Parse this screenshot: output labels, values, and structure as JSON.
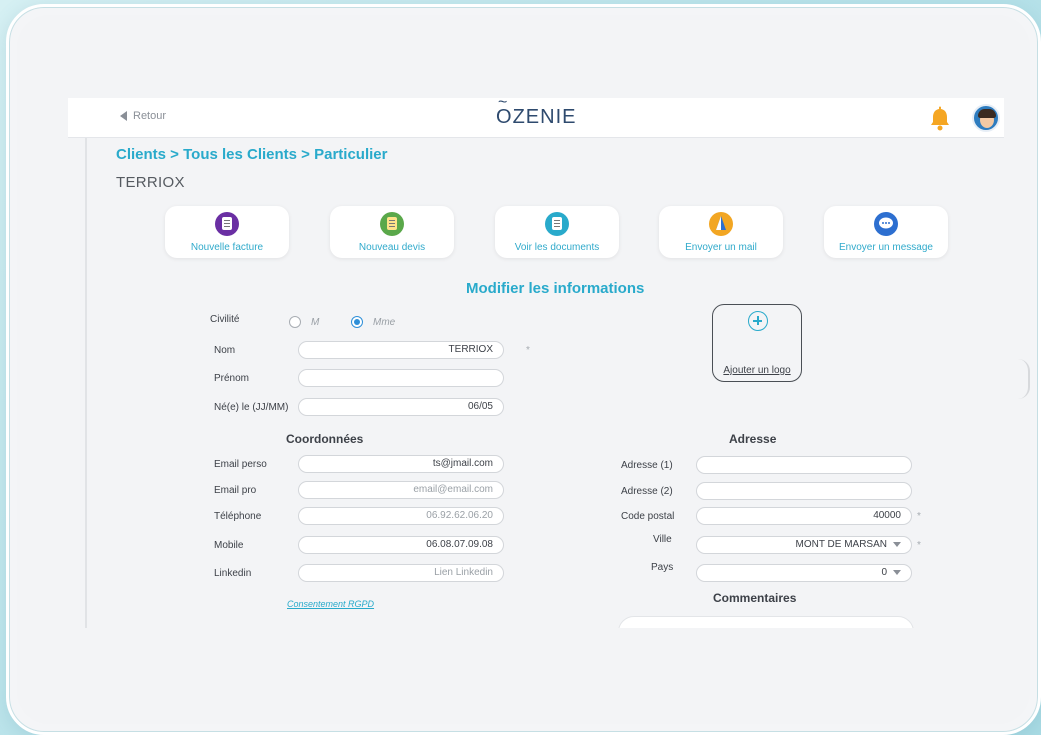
{
  "header": {
    "back_label": "Retour",
    "logo_text": "ZENIE",
    "logo_first_letter": "O"
  },
  "breadcrumb": "Clients > Tous les Clients > Particulier",
  "client_name": "TERRIOX",
  "actions": [
    {
      "label": "Nouvelle facture",
      "icon": "invoice-icon",
      "color": "#6a2fa3"
    },
    {
      "label": "Nouveau devis",
      "icon": "quote-icon",
      "color": "#5aa84a"
    },
    {
      "label": "Voir les documents",
      "icon": "documents-icon",
      "color": "#29aacb"
    },
    {
      "label": "Envoyer un mail",
      "icon": "mail-icon",
      "color": "#f2a623"
    },
    {
      "label": "Envoyer un message",
      "icon": "message-icon",
      "color": "#2d6fd0"
    }
  ],
  "form_title": "Modifier les informations",
  "civilite": {
    "label": "Civilité",
    "options": [
      "M",
      "Mme"
    ],
    "selected": "Mme"
  },
  "identity": {
    "nom_label": "Nom",
    "nom_value": "TERRIOX",
    "prenom_label": "Prénom",
    "prenom_value": "",
    "naissance_label": "Né(e) le (JJ/MM)",
    "naissance_value": "06/05",
    "required_mark": "*"
  },
  "logo_upload": {
    "label": "Ajouter un logo"
  },
  "coordonnees": {
    "title": "Coordonnées",
    "email_perso_label": "Email perso",
    "email_perso_value": "ts@jmail.com",
    "email_pro_label": "Email pro",
    "email_pro_placeholder": "email@email.com",
    "telephone_label": "Téléphone",
    "telephone_placeholder": "06.92.62.06.20",
    "mobile_label": "Mobile",
    "mobile_value": "06.08.07.09.08",
    "linkedin_label": "Linkedin",
    "linkedin_placeholder": "Lien Linkedin",
    "rgpd_link": "Consentement RGPD"
  },
  "adresse": {
    "title": "Adresse",
    "adresse1_label": "Adresse (1)",
    "adresse1_value": "",
    "adresse2_label": "Adresse (2)",
    "adresse2_value": "",
    "code_postal_label": "Code postal",
    "code_postal_value": "40000",
    "ville_label": "Ville",
    "ville_value": "MONT DE MARSAN",
    "pays_label": "Pays",
    "pays_value": "0"
  },
  "commentaires": {
    "title": "Commentaires"
  },
  "colors": {
    "accent": "#29aacb",
    "title_dark": "#3d4148",
    "radio_selected": "#2e8fd8",
    "bell": "#f5a623"
  }
}
